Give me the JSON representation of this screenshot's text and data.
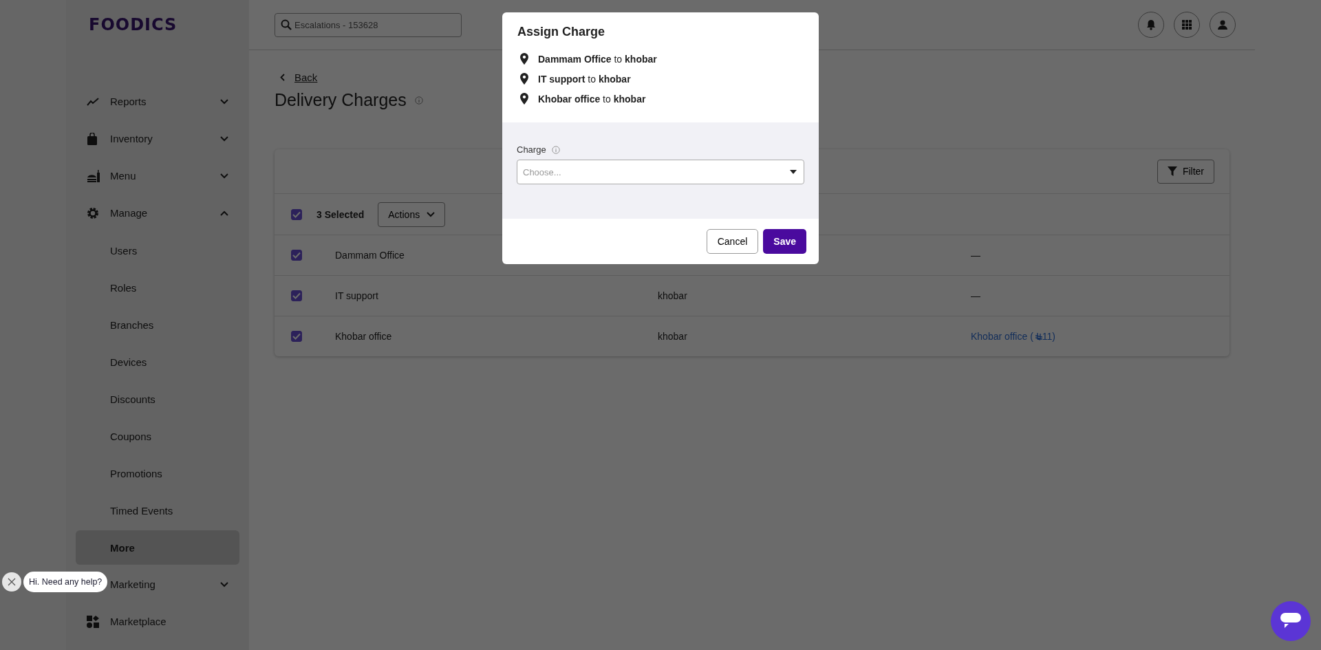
{
  "logo": "FOODICS",
  "sidebar": {
    "items": [
      {
        "kind": "group",
        "label": "Reports",
        "expanded": false
      },
      {
        "kind": "group",
        "label": "Inventory",
        "expanded": false
      },
      {
        "kind": "group",
        "label": "Menu",
        "expanded": false
      },
      {
        "kind": "group",
        "label": "Manage",
        "expanded": true
      },
      {
        "kind": "sub",
        "label": "Users",
        "selected": false
      },
      {
        "kind": "sub",
        "label": "Roles",
        "selected": false
      },
      {
        "kind": "sub",
        "label": "Branches",
        "selected": false
      },
      {
        "kind": "sub",
        "label": "Devices",
        "selected": false
      },
      {
        "kind": "sub",
        "label": "Discounts",
        "selected": false
      },
      {
        "kind": "sub",
        "label": "Coupons",
        "selected": false
      },
      {
        "kind": "sub",
        "label": "Promotions",
        "selected": false
      },
      {
        "kind": "sub",
        "label": "Timed Events",
        "selected": false
      },
      {
        "kind": "sub",
        "label": "More",
        "selected": true
      },
      {
        "kind": "group",
        "label": "Marketing",
        "expanded": false
      },
      {
        "kind": "link",
        "label": "Marketplace"
      }
    ]
  },
  "search": {
    "value": "Escalations - 153628"
  },
  "back": "Back",
  "page_title": "Delivery Charges",
  "toolbar": {
    "filter": "Filter"
  },
  "selection": {
    "checked": true,
    "count": "3 Selected",
    "actions": "Actions"
  },
  "table": {
    "rows": [
      {
        "checked": true,
        "name": "Dammam Office",
        "column_3": {
          "kind": "dash",
          "text": "—"
        }
      },
      {
        "checked": true,
        "name": "IT support",
        "column_2": "khobar",
        "column_3": {
          "kind": "dash",
          "text": "—"
        }
      },
      {
        "checked": true,
        "name": "Khobar office",
        "column_2": "khobar",
        "column_3": {
          "kind": "link",
          "before": "Khobar office (",
          "after": " 11)"
        }
      }
    ]
  },
  "dialog": {
    "title": "Assign Charge",
    "assignments": [
      "**Dammam Office** to **khobar**",
      "**IT support** to **khobar**",
      "**Khobar office** to **khobar**"
    ],
    "field_label": "Charge",
    "placeholder": "Choose...",
    "cancel": "Cancel",
    "save": "Save"
  },
  "chat": {
    "greeting": "Hi. Need any help?"
  }
}
